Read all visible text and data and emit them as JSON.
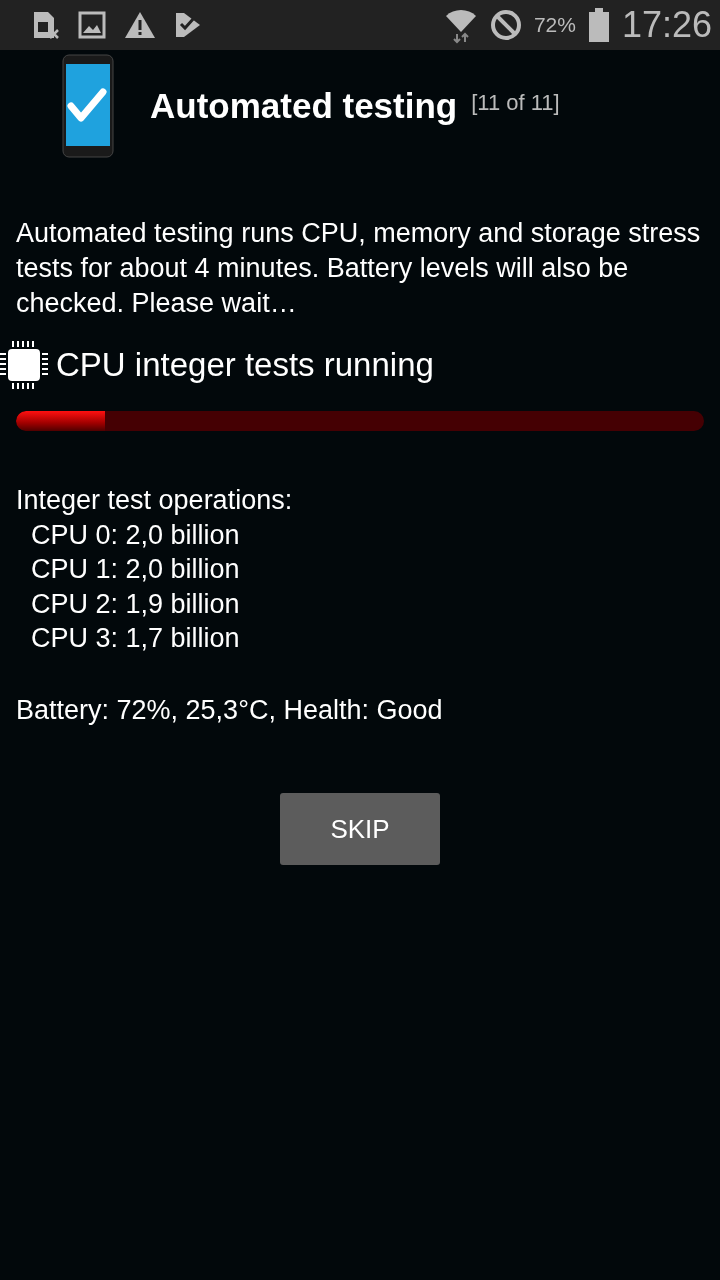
{
  "status_bar": {
    "battery_percent": "72%",
    "time": "17:26"
  },
  "header": {
    "title": "Automated testing",
    "counter": "[11 of 11]"
  },
  "intro": "Automated testing runs CPU, memory and storage stress tests for about 4 minutes. Battery levels will also be checked. Please wait…",
  "test": {
    "label": "CPU integer tests running",
    "level": 0.13
  },
  "results": {
    "heading": "Integer test operations:",
    "lines": [
      "CPU 0: 2,0 billion",
      "CPU 1: 2,0 billion",
      "CPU 2: 1,9 billion",
      "CPU 3: 1,7 billion"
    ]
  },
  "battery_line": "Battery: 72%, 25,3°C, Health: Good",
  "button": "SKIP"
}
